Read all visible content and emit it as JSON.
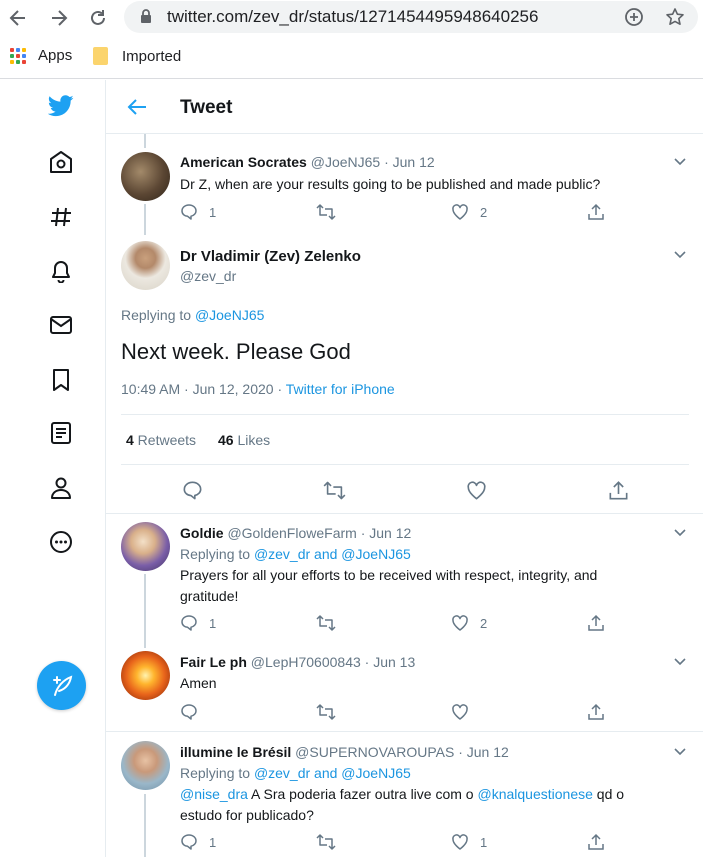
{
  "browser": {
    "url": "twitter.com/zev_dr/status/1271454495948640256",
    "bookmarks": [
      {
        "label": "Apps",
        "icon": "apps-grid-icon"
      },
      {
        "label": "Imported",
        "icon": "folder-icon"
      }
    ]
  },
  "header": {
    "title": "Tweet"
  },
  "colors": {
    "accent": "#1da1f2",
    "link": "#1b95e0",
    "muted": "#657786",
    "text": "#14171a",
    "border": "#e6ecf0"
  },
  "tweets": [
    {
      "name": "American Socrates",
      "handle": "@JoeNJ65",
      "date": "· Jun 12",
      "text": "Dr Z, when are your results going to be published and made public?",
      "replies": "1",
      "retweets": "",
      "likes": "2"
    },
    {
      "name": "Goldie",
      "handle": "@GoldenFloweFarm",
      "date": "· Jun 12",
      "replying_prefix": "Replying to ",
      "replying_to": "@zev_dr and @JoeNJ65",
      "text": "Prayers for all your efforts to be received with respect, integrity, and gratitude!",
      "replies": "1",
      "retweets": "",
      "likes": "2"
    },
    {
      "name": "Fair Le ph",
      "handle": "@LepH70600843",
      "date": "· Jun 13",
      "text": "Amen",
      "replies": "",
      "retweets": "",
      "likes": ""
    },
    {
      "name": "illumine le Brésil",
      "handle": "@SUPERNOVAROUPAS",
      "date": "· Jun 12",
      "replying_prefix": "Replying to ",
      "replying_to": "@zev_dr and @JoeNJ65",
      "mention1": "@nise_dra",
      "text_mid": " A Sra poderia fazer outra live com o ",
      "mention2": "@knalquestionese",
      "text_end": " qd o estudo for publicado?",
      "replies": "1",
      "retweets": "",
      "likes": "1"
    }
  ],
  "focus": {
    "name": "Dr Vladimir (Zev) Zelenko",
    "handle": "@zev_dr",
    "replying_prefix": "Replying to ",
    "replying_to": "@JoeNJ65",
    "text": "Next week. Please God",
    "time": "10:49 AM · Jun 12, 2020 · ",
    "source": "Twitter for iPhone",
    "retweets_count": "4",
    "retweets_label": " Retweets",
    "likes_count": "46",
    "likes_label": " Likes"
  }
}
